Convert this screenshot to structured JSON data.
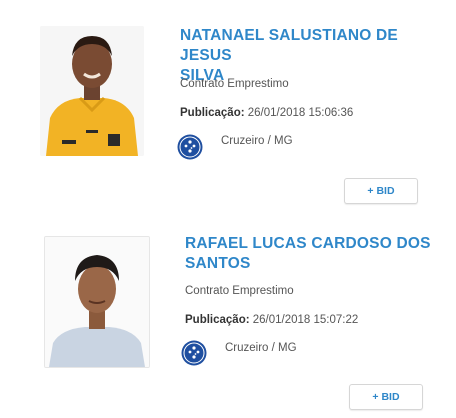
{
  "players": [
    {
      "name_line1": "NATANAEL SALUSTIANO DE JESUS",
      "name_line2": "SILVA",
      "contract_type": "Contrato Emprestimo",
      "publication_label": "Publicação:",
      "publication_datetime": "26/01/2018 15:06:36",
      "club": "Cruzeiro / MG",
      "bid_label": "+ BID"
    },
    {
      "name_line1": "RAFAEL LUCAS CARDOSO DOS",
      "name_line2": "SANTOS",
      "contract_type": "Contrato Emprestimo",
      "publication_label": "Publicação:",
      "publication_datetime": "26/01/2018 15:07:22",
      "club": "Cruzeiro / MG",
      "bid_label": "+ BID"
    }
  ],
  "colors": {
    "accent": "#2f87c9",
    "club_blue": "#1f4fa0"
  }
}
